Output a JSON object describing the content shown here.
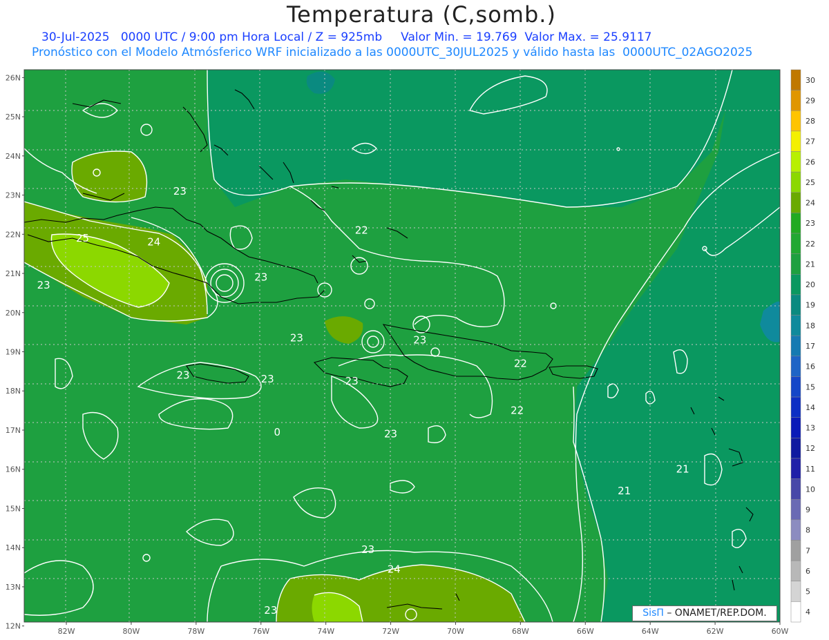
{
  "header": {
    "title": "Temperatura (C,somb.)",
    "line1": "30-Jul-2025   0000 UTC / 9:00 pm Hora Local / Z = 925mb     Valor Min. = 19.769  Valor Max. = 25.9117",
    "line2": "Pronóstico con el Modelo Atmósferico WRF inicializado a las 0000UTC_30JUL2025 y válido hasta las  0000UTC_02AGO2025"
  },
  "credit": {
    "brand": "SisΠ",
    "text": "– ONAMET/REP.DOM."
  },
  "map": {
    "lat_labels": [
      "26N",
      "25N",
      "24N",
      "23N",
      "22N",
      "21N",
      "20N",
      "19N",
      "18N",
      "17N",
      "16N",
      "15N",
      "14N",
      "13N",
      "12N"
    ],
    "lon_labels": [
      "82W",
      "80W",
      "78W",
      "76W",
      "74W",
      "72W",
      "70W",
      "68W",
      "66W",
      "64W",
      "62W",
      "60W"
    ],
    "contour_labels": [
      {
        "text": "23",
        "lon": -78.5,
        "lat": 23.1
      },
      {
        "text": "25",
        "lon": -81.5,
        "lat": 21.9
      },
      {
        "text": "24",
        "lon": -79.3,
        "lat": 21.8
      },
      {
        "text": "23",
        "lon": -82.7,
        "lat": 20.7
      },
      {
        "text": "23",
        "lon": -76.0,
        "lat": 20.9
      },
      {
        "text": "22",
        "lon": -72.9,
        "lat": 22.1
      },
      {
        "text": "23",
        "lon": -74.9,
        "lat": 19.35
      },
      {
        "text": "23",
        "lon": -71.1,
        "lat": 19.3
      },
      {
        "text": "22",
        "lon": -68.0,
        "lat": 18.7
      },
      {
        "text": "23",
        "lon": -78.4,
        "lat": 18.4
      },
      {
        "text": "23",
        "lon": -75.8,
        "lat": 18.3
      },
      {
        "text": "23",
        "lon": -73.2,
        "lat": 18.25
      },
      {
        "text": "0",
        "lon": -75.5,
        "lat": 16.95
      },
      {
        "text": "23",
        "lon": -72.0,
        "lat": 16.9
      },
      {
        "text": "22",
        "lon": -68.1,
        "lat": 17.5
      },
      {
        "text": "21",
        "lon": -63.0,
        "lat": 16.0
      },
      {
        "text": "21",
        "lon": -64.8,
        "lat": 15.45
      },
      {
        "text": "23",
        "lon": -72.7,
        "lat": 13.95
      },
      {
        "text": "24",
        "lon": -71.9,
        "lat": 13.45
      },
      {
        "text": "23",
        "lon": -75.7,
        "lat": 12.4
      }
    ]
  },
  "colorbar": {
    "labels": [
      "30",
      "29",
      "28",
      "27",
      "26",
      "25",
      "24",
      "23",
      "22",
      "21",
      "20",
      "19",
      "18",
      "17",
      "16",
      "15",
      "14",
      "13",
      "12",
      "11",
      "10",
      "9",
      "8",
      "7",
      "6",
      "5",
      "4"
    ],
    "colors": [
      "#c07800",
      "#e09600",
      "#ffc400",
      "#f4f000",
      "#b8f000",
      "#8cd800",
      "#6aaa00",
      "#22aa22",
      "#22a832",
      "#1ea040",
      "#0a9860",
      "#0a8a80",
      "#0f8a9c",
      "#167ab2",
      "#1e64c6",
      "#1446c8",
      "#0c2ec4",
      "#0a1ab8",
      "#101aa0",
      "#2020a8",
      "#4848a8",
      "#6a6ab4",
      "#8c8cc0",
      "#a0a0a0",
      "#b8b8b8",
      "#d4d4d4",
      "#ffffff"
    ]
  },
  "colors": {
    "field_base": "#1ea040",
    "field_cool": "#0a9860",
    "field_warm": "#22aa22",
    "field_hot": "#6aaa00",
    "field_hotter": "#8cd800"
  }
}
